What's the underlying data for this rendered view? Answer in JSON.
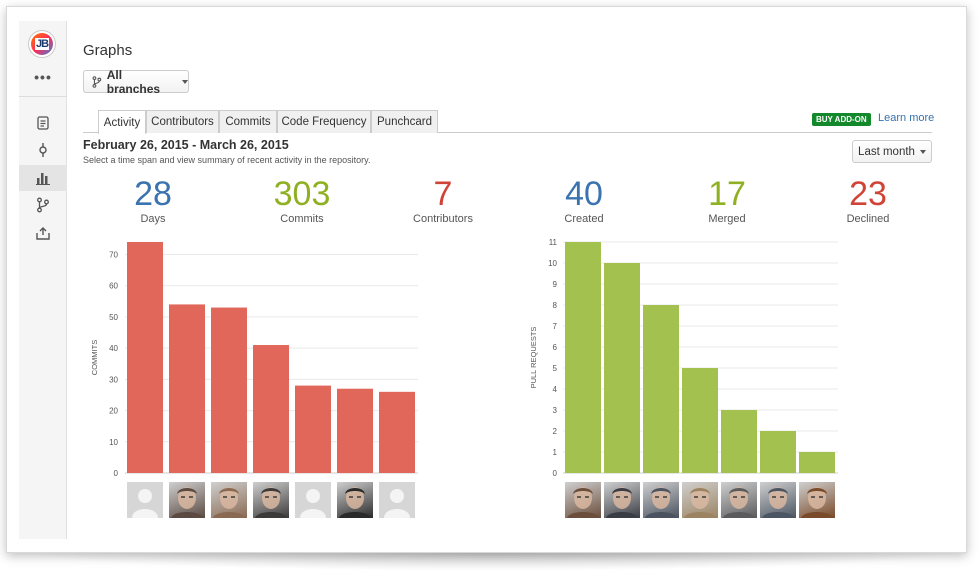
{
  "sidebar": {
    "logo_text": "JB",
    "more": "•••",
    "icons": [
      "document-icon",
      "commit-icon",
      "graph-icon",
      "branch-icon",
      "upload-icon"
    ]
  },
  "header": {
    "title": "Graphs",
    "branch_selector": "All branches"
  },
  "tabs": [
    "Activity",
    "Contributors",
    "Commits",
    "Code Frequency",
    "Punchcard"
  ],
  "addon": {
    "badge": "BUY ADD-ON",
    "link": "Learn more"
  },
  "period": {
    "date_range": "February 26, 2015 - March 26, 2015",
    "hint": "Select a time span and view summary of recent activity in the repository.",
    "selector": "Last month"
  },
  "stats": [
    {
      "value": "28",
      "label": "Days",
      "color": "#3b73af"
    },
    {
      "value": "303",
      "label": "Commits",
      "color": "#8eb021"
    },
    {
      "value": "7",
      "label": "Contributors",
      "color": "#d04437"
    },
    {
      "value": "40",
      "label": "Created",
      "color": "#3b73af"
    },
    {
      "value": "17",
      "label": "Merged",
      "color": "#8eb021"
    },
    {
      "value": "23",
      "label": "Declined",
      "color": "#d04437"
    }
  ],
  "chart_data": [
    {
      "type": "bar",
      "ylabel": "COMMITS",
      "ylim": [
        0,
        74
      ],
      "yticks": [
        0,
        10,
        20,
        30,
        40,
        50,
        60,
        70
      ],
      "values": [
        74,
        54,
        53,
        41,
        28,
        27,
        26
      ],
      "color": "#e0675a",
      "grid": true
    },
    {
      "type": "bar",
      "ylabel": "PULL REQUESTS",
      "ylim": [
        0,
        11
      ],
      "yticks": [
        0,
        1,
        2,
        3,
        4,
        5,
        6,
        7,
        8,
        9,
        10,
        11
      ],
      "values": [
        11,
        10,
        8,
        5,
        3,
        2,
        1
      ],
      "color": "#a3c14f",
      "grid": true
    }
  ],
  "colors": {
    "accent": "#3572b0",
    "badge": "#14892c"
  }
}
